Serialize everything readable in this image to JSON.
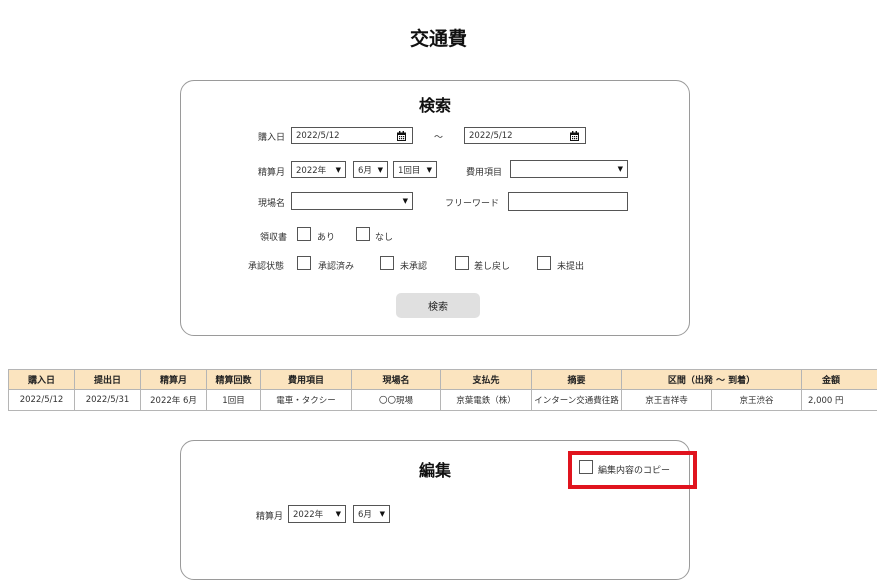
{
  "page": {
    "title": "交通費"
  },
  "search": {
    "title": "検索",
    "purchase_date_label": "購入日",
    "purchase_date_from": "2022/5/12",
    "range_sep": "～",
    "purchase_date_to": "2022/5/12",
    "settle_month_label": "精算月",
    "settle_year": "2022年",
    "settle_month": "6月",
    "settle_count": "1回目",
    "expense_item_label": "費用項目",
    "expense_item_value": "",
    "site_label": "現場名",
    "site_value": "",
    "freeword_label": "フリーワード",
    "freeword_value": "",
    "receipt_label": "領収書",
    "receipt_options": [
      "あり",
      "なし"
    ],
    "approval_label": "承認状態",
    "approval_options": [
      "承認済み",
      "未承認",
      "差し戻し",
      "未提出"
    ],
    "search_button": "検索"
  },
  "table": {
    "headers": [
      "購入日",
      "提出日",
      "精算月",
      "精算回数",
      "費用項目",
      "現場名",
      "支払先",
      "摘要",
      "区間（出発 ～ 到着）",
      "金額"
    ],
    "rows": [
      [
        "2022/5/12",
        "2022/5/31",
        "2022年 6月",
        "1回目",
        "電車・タクシー",
        "〇〇現場",
        "京葉電鉄（株）",
        "インターン交通費往路",
        "京王吉祥寺",
        "京王渋谷",
        "2,000 円"
      ]
    ]
  },
  "edit": {
    "title": "編集",
    "copy_label": "編集内容のコピー",
    "settle_month_label": "精算月",
    "settle_year": "2022年",
    "settle_month": "6月"
  },
  "colors": {
    "header_bg": "#fbe4bf",
    "highlight": "#e0141e",
    "button_bg": "#e0e0e0"
  }
}
